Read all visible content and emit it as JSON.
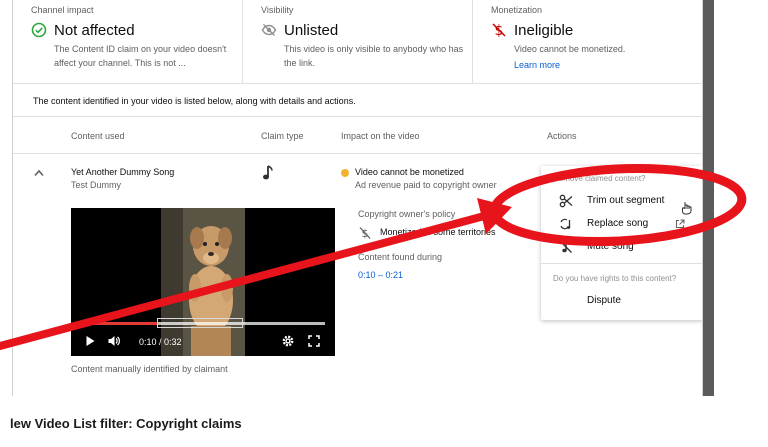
{
  "status_cards": [
    {
      "label": "Channel impact",
      "value": "Not affected",
      "icon": "check-circle-icon",
      "description": "The Content ID claim on your video doesn't affect your channel. This is not ..."
    },
    {
      "label": "Visibility",
      "value": "Unlisted",
      "icon": "eye-off-icon",
      "description": "This video is only visible to anybody who has the link."
    },
    {
      "label": "Monetization",
      "value": "Ineligible",
      "icon": "no-money-icon",
      "description": "Video cannot be monetized.",
      "link": "Learn more"
    }
  ],
  "intro_text": "The content identified in your video is listed below, along with details and actions.",
  "table_headers": {
    "content_used": "Content used",
    "claim_type": "Claim type",
    "impact": "Impact on the video",
    "actions": "Actions"
  },
  "claim": {
    "song_title": "Yet Another Dummy Song",
    "artist": "Test Dummy",
    "claim_type_icon": "music-note-icon",
    "impact": "Video cannot be monetized",
    "impact_sub": "Ad revenue paid to copyright owner",
    "policy_label": "Copyright owner's policy",
    "policy_value": "Monetized in some territories",
    "found_label": "Content found during",
    "found_value": "0:10 – 0:21",
    "caption": "Content manually identified by claimant"
  },
  "video": {
    "time": "0:10 / 0:32",
    "progress": 0.31
  },
  "actions_menu": {
    "header": "Remove claimed content?",
    "items": [
      {
        "label": "Trim out segment",
        "icon": "scissors-icon"
      },
      {
        "label": "Replace song",
        "icon": "replace-song-icon",
        "external": "open-new-icon"
      },
      {
        "label": "Mute song",
        "icon": "mute-song-icon"
      }
    ],
    "header2": "Do you have rights to this content?",
    "dispute": "Dispute"
  },
  "annotation_color": "#e8141b",
  "footer_caption": "lew Video List filter: Copyright claims"
}
